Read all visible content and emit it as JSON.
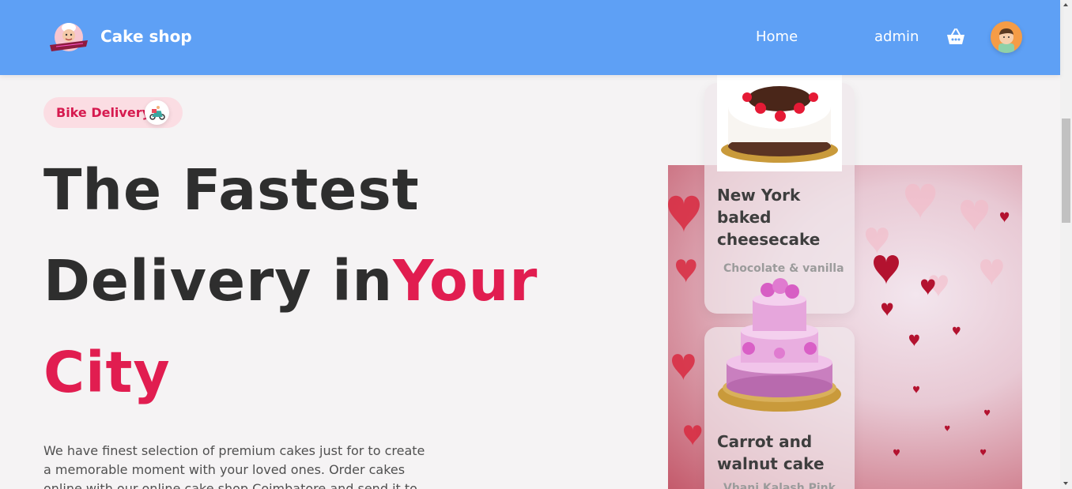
{
  "header": {
    "brand": "Cake shop",
    "nav": {
      "home": "Home",
      "admin": "admin"
    },
    "icons": {
      "logo": "cake-shop-logo",
      "cart": "shopping-basket-icon",
      "avatar": "user-avatar"
    },
    "colors": {
      "background": "#5ea0f5",
      "text": "#ffffff"
    }
  },
  "hero": {
    "badge": {
      "label": "Bike Delivery",
      "icon": "scooter-delivery-icon"
    },
    "headline": {
      "line1": "The Fastest",
      "line2_plain": "Delivery in",
      "line2_accent": "Your",
      "line3_accent": "City"
    },
    "description": "We have finest selection of premium cakes just for to create a memorable moment with your loved ones. Order cakes online with our online cake shop Coimbatore and send it to",
    "accent_color": "#e11d50",
    "background_image": "hearts-bokeh-background"
  },
  "cards": [
    {
      "title": "New York baked cheesecake",
      "subtitle": "Chocolate & vanilla",
      "image": "black-forest-cake"
    },
    {
      "title": "Carrot and walnut cake",
      "subtitle": "Vhani Kalash Pink",
      "image": "pink-tiered-rose-cake"
    }
  ]
}
